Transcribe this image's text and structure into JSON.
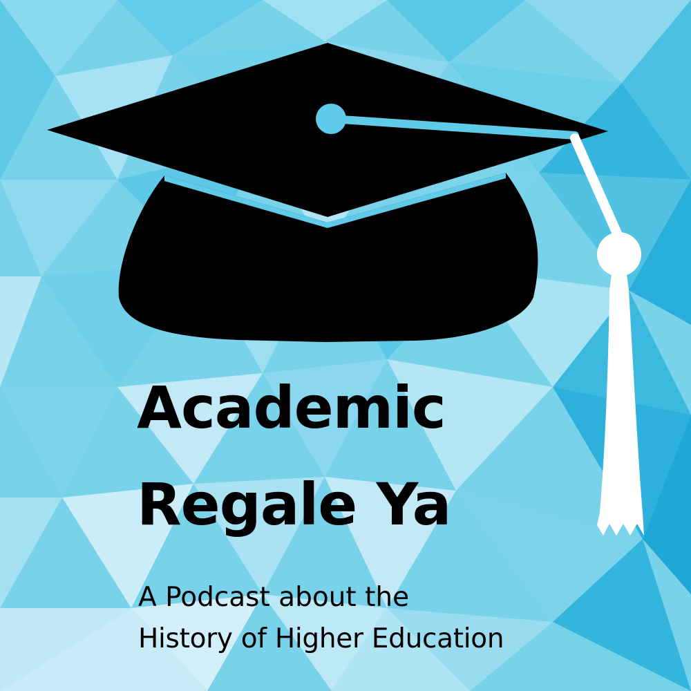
{
  "podcast": {
    "title_line_1": "Academic",
    "title_line_2": "Regale Ya",
    "subtitle_line_1": "A Podcast about the",
    "subtitle_line_2": "History of Higher Education"
  },
  "artwork": {
    "icon": "graduation-cap-icon",
    "background_style": "low-poly geometric triangles",
    "colors": {
      "background_light": "#c4e8f4",
      "background_mid": "#6fd0ea",
      "background_deep": "#1ea7d7",
      "cap": "#000000",
      "button_and_cord": "#5fcbe8",
      "tassel": "#ffffff",
      "text": "#000000"
    }
  }
}
